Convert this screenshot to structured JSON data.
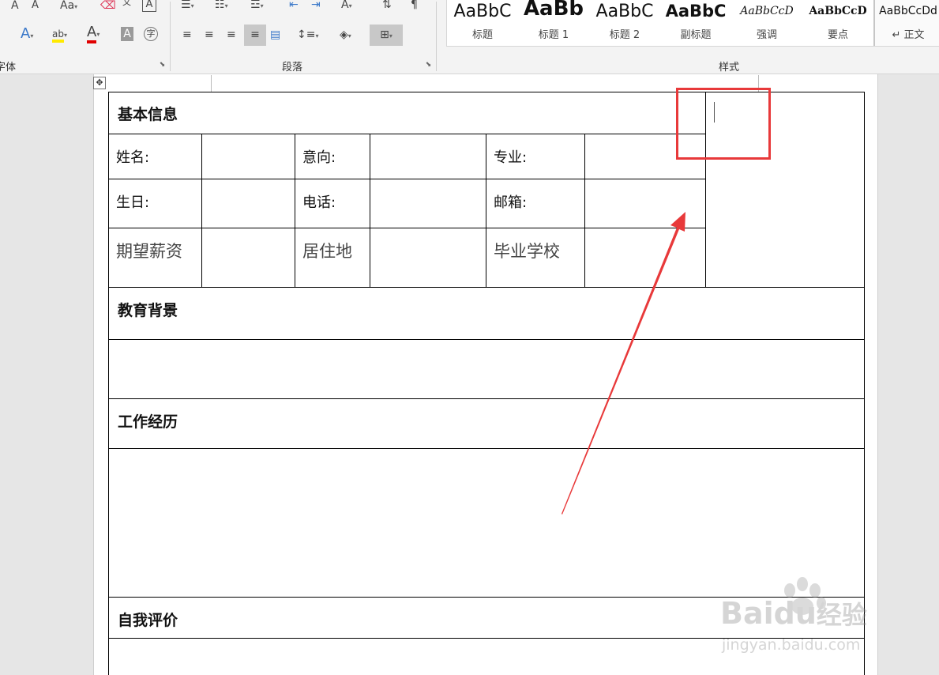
{
  "ribbon": {
    "font_group_label": "字体",
    "paragraph_group_label": "段落",
    "styles_group_label": "样式",
    "font_tools": [
      "A",
      "A",
      "Aa",
      "文"
    ],
    "styles": [
      {
        "sample": "AaBbC",
        "name": "标题"
      },
      {
        "sample": "AaBb",
        "name": "标题 1"
      },
      {
        "sample": "AaBbC",
        "name": "标题 2"
      },
      {
        "sample": "AaBbC",
        "name": "副标题"
      },
      {
        "sample": "AaBbCcD",
        "name": "强调"
      },
      {
        "sample": "AaBbCcD",
        "name": "要点"
      },
      {
        "sample": "AaBbCcDd",
        "name": "↵ 正文"
      }
    ]
  },
  "document": {
    "sections": {
      "basic_info": "基本信息",
      "education": "教育背景",
      "work": "工作经历",
      "self_eval": "自我评价"
    },
    "fields": {
      "name": "姓名:",
      "intent": "意向:",
      "major": "专业:",
      "birthday": "生日:",
      "phone": "电话:",
      "email": "邮箱:",
      "salary": "期望薪资",
      "residence": "居住地",
      "school": "毕业学校"
    }
  },
  "watermark": {
    "brand": "Baidu",
    "suffix": "经验",
    "url": "jingyan.baidu.com"
  },
  "colors": {
    "annotation": "#e8393a",
    "ribbon_bg": "#f3f3f3",
    "page_bg": "#ffffff"
  }
}
